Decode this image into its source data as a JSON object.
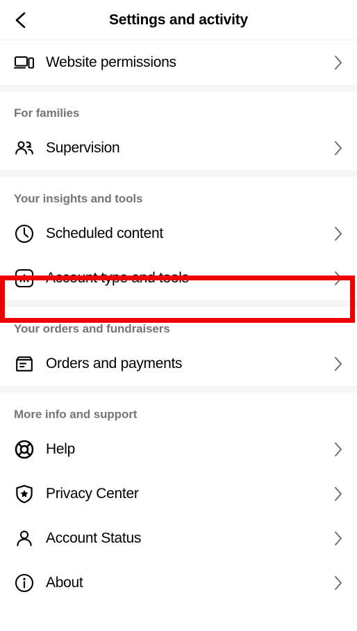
{
  "header": {
    "title": "Settings and activity",
    "back_icon": "chevron-left-icon"
  },
  "colors": {
    "background": "#ffffff",
    "section_divider": "#f6f6f6",
    "section_title": "#737576",
    "row_label": "#000000",
    "chevron": "#6c6e6f",
    "highlight": "#ee0000"
  },
  "sections": [
    {
      "id": "top",
      "title": null,
      "items": [
        {
          "label": "Website permissions",
          "icon": "devices-icon",
          "chevron": "chevron-right-icon"
        }
      ]
    },
    {
      "id": "for-families",
      "title": "For families",
      "items": [
        {
          "label": "Supervision",
          "icon": "people-icon",
          "chevron": "chevron-right-icon"
        }
      ]
    },
    {
      "id": "your-insights-and-tools",
      "title": "Your insights and tools",
      "items": [
        {
          "label": "Scheduled content",
          "icon": "clock-icon",
          "chevron": "chevron-right-icon"
        },
        {
          "label": "Account type and tools",
          "icon": "bar-chart-icon",
          "chevron": "chevron-right-icon",
          "highlighted": true
        }
      ]
    },
    {
      "id": "your-orders-and-fundraisers",
      "title": "Your orders and fundraisers",
      "items": [
        {
          "label": "Orders and payments",
          "icon": "box-receipt-icon",
          "chevron": "chevron-right-icon"
        }
      ]
    },
    {
      "id": "more-info-and-support",
      "title": "More info and support",
      "items": [
        {
          "label": "Help",
          "icon": "lifebuoy-icon",
          "chevron": "chevron-right-icon"
        },
        {
          "label": "Privacy Center",
          "icon": "shield-star-icon",
          "chevron": "chevron-right-icon"
        },
        {
          "label": "Account Status",
          "icon": "person-icon",
          "chevron": "chevron-right-icon"
        },
        {
          "label": "About",
          "icon": "info-circle-icon",
          "chevron": "chevron-right-icon"
        }
      ]
    }
  ]
}
